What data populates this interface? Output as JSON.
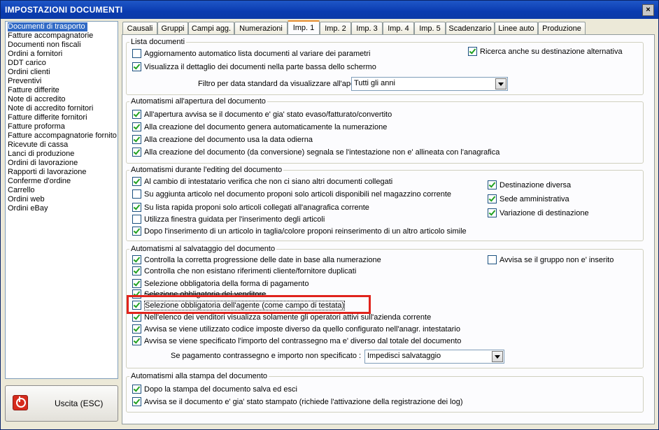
{
  "window": {
    "title": "IMPOSTAZIONI DOCUMENTI",
    "close_label": "×"
  },
  "documents": [
    "Documenti di trasporto",
    "Fatture accompagnatorie",
    "Documenti non fiscali",
    "Ordini a fornitori",
    "DDT carico",
    "Ordini clienti",
    "Preventivi",
    "Fatture differite",
    "Note di accredito",
    "Note di accredito fornitori",
    "Fatture differite fornitori",
    "Fatture proforma",
    "Fatture accompagnatorie fornito",
    "Ricevute di cassa",
    "Lanci di produzione",
    "Ordini di lavorazione",
    "Rapporti di lavorazione",
    "Conferme d'ordine",
    "Carrello",
    "Ordini web",
    "Ordini eBay"
  ],
  "exit_button": {
    "label": "Uscita (ESC)"
  },
  "tabs": [
    "Causali",
    "Gruppi",
    "Campi agg.",
    "Numerazioni",
    "Imp. 1",
    "Imp. 2",
    "Imp. 3",
    "Imp. 4",
    "Imp. 5",
    "Scadenzario",
    "Linee auto",
    "Produzione"
  ],
  "lista": {
    "title": "Lista documenti",
    "c1": "Aggiornamento automatico lista documenti al variare dei parametri",
    "c2": "Visualizza il dettaglio dei documenti nella parte bassa dello schermo",
    "c3": "Ricerca anche su destinazione alternativa",
    "filter_label": "Filtro per data standard da visualizzare all'apertura :",
    "filter_value": "Tutti gli anni"
  },
  "apertura": {
    "title": "Automatismi all'apertura del documento",
    "c1": "All'apertura avvisa se il documento e' gia' stato evaso/fatturato/convertito",
    "c2": "Alla creazione del documento genera automaticamente la numerazione",
    "c3": "Alla creazione del documento usa la data odierna",
    "c4": "Alla creazione del documento (da conversione) segnala se l'intestazione non e' allineata con l'anagrafica"
  },
  "editing": {
    "title": "Automatismi durante l'editing del documento",
    "c1": "Al cambio di intestatario verifica che non ci siano altri documenti collegati",
    "c2": "Su aggiunta articolo nel documento proponi solo articoli disponibili nel magazzino corrente",
    "c3": "Su lista rapida proponi solo articoli collegati all'anagrafica corrente",
    "c4": "Utilizza finestra guidata per l'inserimento degli articoli",
    "c5": "Dopo l'inserimento di un articolo in taglia/colore proponi reinserimento di un altro articolo simile",
    "r1": "Destinazione diversa",
    "r2": "Sede amministrativa",
    "r3": "Variazione di destinazione"
  },
  "salvataggio": {
    "title": "Automatismi al salvataggio del documento",
    "c1": "Controlla la corretta progressione delle date in base alla numerazione",
    "c2": "Controlla che non esistano riferimenti cliente/fornitore duplicati",
    "c3": "Selezione obbligatoria della forma di pagamento",
    "c4": "Selezione obbligatoria del venditore",
    "c5": "Selezione obbligatoria dell'agente (come campo di testata)",
    "c6": "Nell'elenco dei venditori visualizza solamente gli operatori attivi sull'azienda corrente",
    "c7": "Avvisa se viene utilizzato codice imposte diverso da quello configurato nell'anagr. intestatario",
    "c8": "Avvisa se viene specificato l'importo del contrassegno ma e' diverso dal totale del documento",
    "r1": "Avvisa se il gruppo non e' inserito",
    "pay_label": "Se pagamento contrassegno e importo non specificato :",
    "pay_value": "Impedisci salvataggio"
  },
  "stampa": {
    "title": "Automatismi alla stampa del documento",
    "c1": "Dopo la stampa del documento salva ed esci",
    "c2": "Avvisa se il documento e' gia' stato stampato (richiede l'attivazione della registrazione dei log)"
  }
}
